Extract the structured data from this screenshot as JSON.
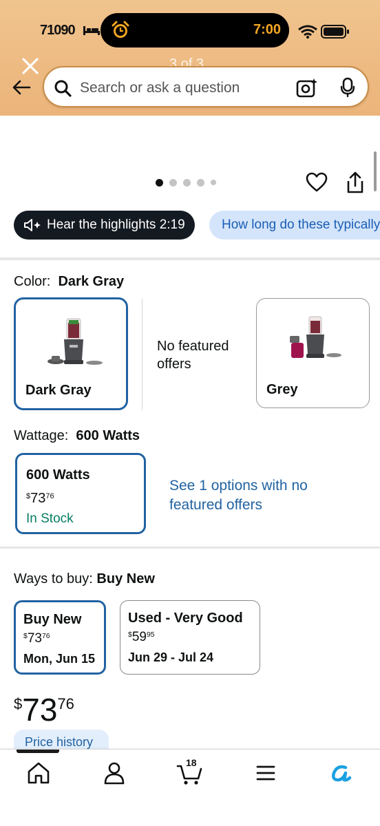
{
  "status_bar": {
    "left_text": "71090",
    "time": "7:00"
  },
  "header": {
    "page_count": "3 of 3",
    "search_placeholder": "Search or ask a question"
  },
  "carousel": {
    "dot_count": 5,
    "active_dot": 1
  },
  "highlights": {
    "hear_label": "Hear the highlights 2:19",
    "question_chip": "How long do these typically last?"
  },
  "color": {
    "label": "Color:",
    "selected": "Dark Gray",
    "options": [
      {
        "name": "Dark Gray"
      },
      {
        "name": "No featured offers"
      },
      {
        "name": "Grey"
      }
    ]
  },
  "wattage": {
    "label": "Wattage:",
    "selected": "600 Watts",
    "card": {
      "title": "600 Watts",
      "currency": "$",
      "price_whole": "73",
      "price_cents": "76",
      "stock": "In Stock"
    },
    "see_options": "See 1 options with no featured offers"
  },
  "ways_to_buy": {
    "label": "Ways to buy:",
    "selected": "Buy New",
    "options": [
      {
        "title": "Buy New",
        "currency": "$",
        "price_whole": "73",
        "price_cents": "76",
        "date": "Mon, Jun 15"
      },
      {
        "title": "Used - Very Good",
        "currency": "$",
        "price_whole": "59",
        "price_cents": "95",
        "date": "Jun 29 - Jul 24"
      }
    ]
  },
  "price": {
    "currency": "$",
    "whole": "73",
    "cents": "76",
    "history_label": "Price history"
  },
  "bottom_nav": {
    "items": [
      "home-icon",
      "account-icon",
      "cart-icon",
      "menu-icon",
      "rufus-icon"
    ],
    "cart_count": "18"
  },
  "colors": {
    "header_bg": "#ebb47a",
    "selected_border": "#2162a1",
    "link": "#2162a1",
    "in_stock": "#067d62",
    "chip_bg": "#d4e5fb",
    "rufus": "#1ba0e2"
  }
}
